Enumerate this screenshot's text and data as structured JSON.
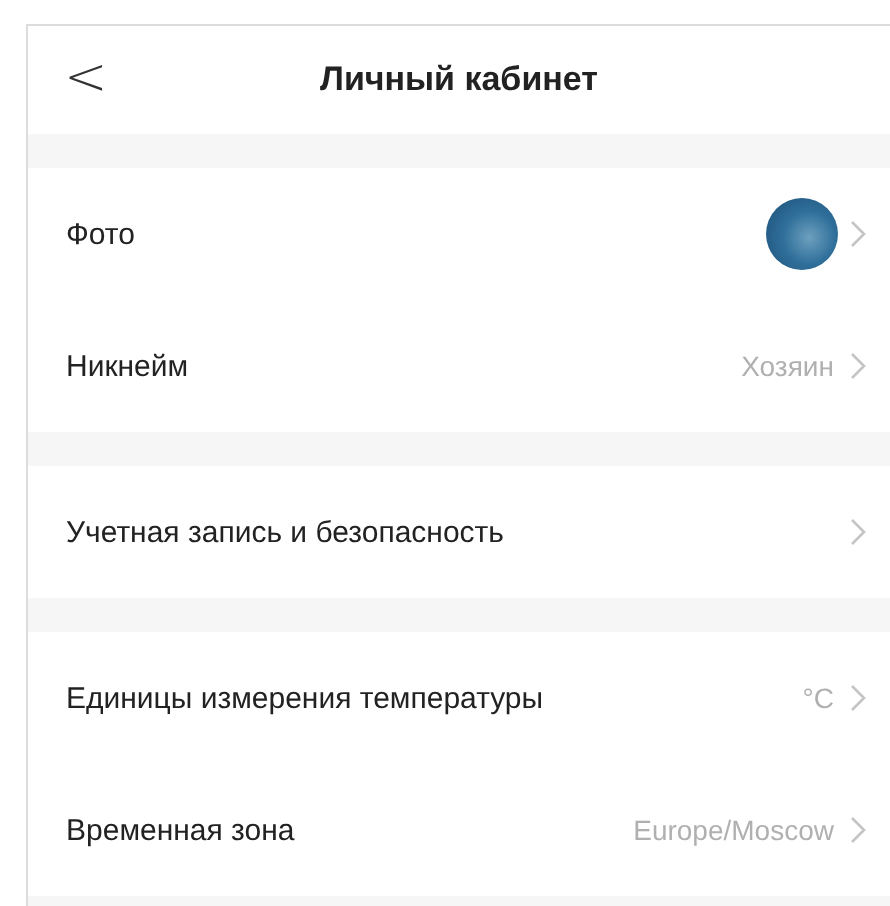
{
  "header": {
    "back": "<",
    "title": "Личный кабинет"
  },
  "groups": [
    {
      "rows": [
        {
          "kind": "avatar",
          "label": "Фото"
        },
        {
          "kind": "value",
          "label": "Никнейм",
          "value": "Хозяин"
        }
      ]
    },
    {
      "rows": [
        {
          "kind": "plain",
          "label": "Учетная запись и безопасность"
        }
      ]
    },
    {
      "rows": [
        {
          "kind": "value",
          "label": "Единицы измерения температуры",
          "value": "°C"
        },
        {
          "kind": "value",
          "label": "Временная зона",
          "value": "Europe/Moscow"
        }
      ]
    }
  ]
}
